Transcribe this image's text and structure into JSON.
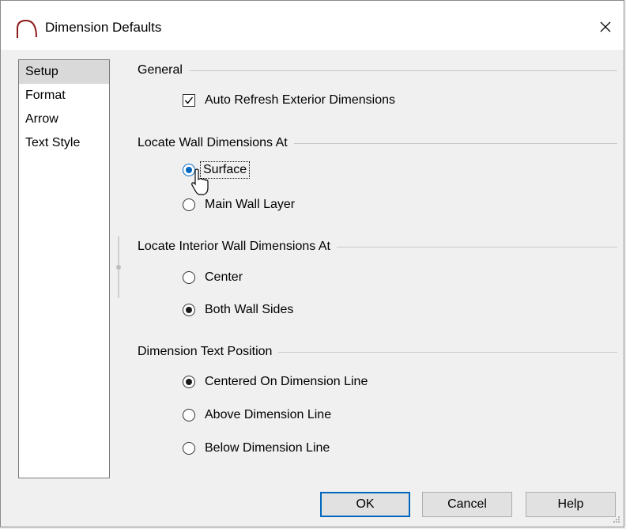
{
  "window": {
    "title": "Dimension Defaults"
  },
  "sidebar": {
    "items": [
      {
        "label": "Setup",
        "selected": true
      },
      {
        "label": "Format"
      },
      {
        "label": "Arrow"
      },
      {
        "label": "Text Style"
      }
    ]
  },
  "general": {
    "header": "General",
    "auto_refresh_label": "Auto Refresh Exterior Dimensions",
    "auto_refresh_checked": true
  },
  "locate_wall": {
    "header": "Locate Wall Dimensions At",
    "options": [
      "Surface",
      "Main Wall Layer"
    ],
    "selected": "Surface"
  },
  "locate_interior": {
    "header": "Locate Interior Wall Dimensions At",
    "options": [
      "Center",
      "Both Wall Sides"
    ],
    "selected": "Both Wall Sides"
  },
  "text_position": {
    "header": "Dimension Text Position",
    "options": [
      "Centered On Dimension Line",
      "Above Dimension Line",
      "Below Dimension Line"
    ],
    "selected": "Centered On Dimension Line"
  },
  "buttons": {
    "ok": "OK",
    "cancel": "Cancel",
    "help": "Help"
  },
  "colors": {
    "accent": "#0067c0",
    "selection": "#d9d9d9"
  }
}
